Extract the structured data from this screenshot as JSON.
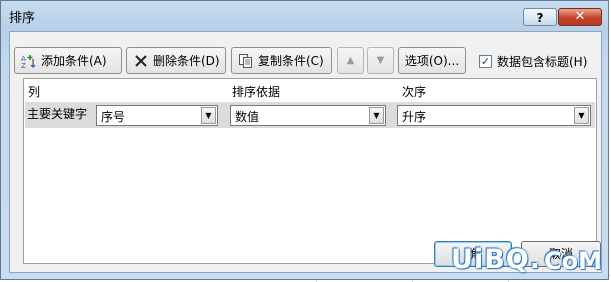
{
  "dialog": {
    "title": "排序",
    "help_label": "?",
    "close_label": "✕"
  },
  "toolbar": {
    "add_level": "添加条件(A)",
    "delete_level": "删除条件(D)",
    "copy_level": "复制条件(C)",
    "move_up": "▲",
    "move_down": "▼",
    "options": "选项(O)...",
    "has_headers_label": "数据包含标题(H)",
    "has_headers_checked": true
  },
  "grid": {
    "headers": [
      "列",
      "排序依据",
      "次序"
    ],
    "rows": [
      {
        "label": "主要关键字",
        "column": "序号",
        "sort_on": "数值",
        "order": "升序"
      }
    ]
  },
  "footer": {
    "ok_partial": "确",
    "cancel_partial": "取消"
  },
  "watermark": {
    "main": "UiBQ.",
    "sub": "CoM"
  },
  "colors": {
    "title_bar": "#b9d1ea",
    "close_button": "#c7432c",
    "client_bg": "#f0f0f0",
    "watermark_outline": "#2d7cd1"
  }
}
